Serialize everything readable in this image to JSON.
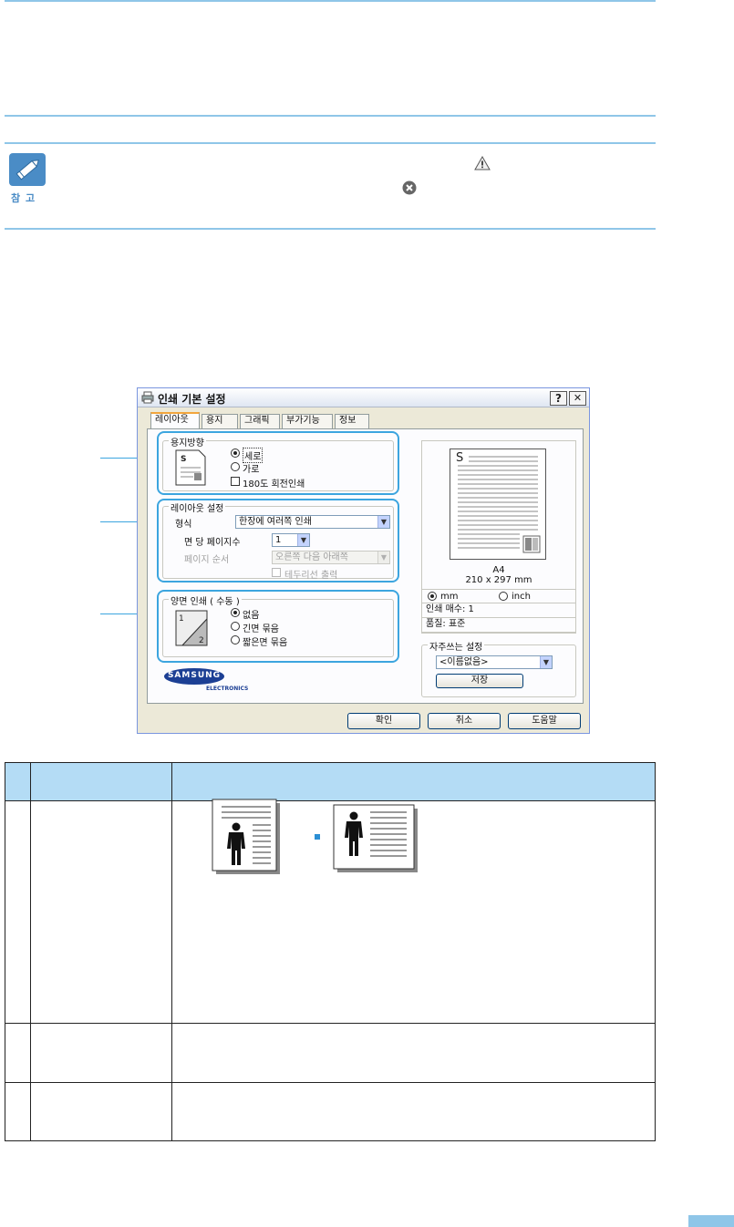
{
  "note": {
    "label": "참 고"
  },
  "dialog": {
    "title": "인쇄 기본 설정",
    "help_btn": "?",
    "close_btn": "✕",
    "tabs": [
      "레이아웃",
      "용지",
      "그래픽",
      "부가기능",
      "정보"
    ],
    "orientation": {
      "title": "용지방향",
      "portrait": "세로",
      "landscape": "가로",
      "rotate": "180도 회전인쇄",
      "selected": "portrait"
    },
    "layout": {
      "title": "레이아웃 설정",
      "type_label": "형식",
      "type_value": "한장에 여러쪽 인쇄",
      "pages_label": "면 당 페이지수",
      "pages_value": "1",
      "order_label": "페이지 순서",
      "order_value": "오른쪽 다음 아래쪽",
      "border_label": "테두리선 출력"
    },
    "duplex": {
      "title": "양면 인쇄 ( 수동 )",
      "none": "없음",
      "long": "긴면 묶음",
      "short": "짧은면 묶음",
      "selected": "none"
    },
    "preview": {
      "letter": "S",
      "paper": "A4",
      "size": "210 x 297 mm",
      "unit_mm": "mm",
      "unit_inch": "inch",
      "copies": "인쇄 매수: 1",
      "quality": "품질: 표준"
    },
    "favorites": {
      "title": "자주쓰는 설정",
      "value": "<이름없음>",
      "save": "저장"
    },
    "brand": {
      "name": "SAMSUNG",
      "sub": "ELECTRONICS"
    },
    "buttons": {
      "ok": "확인",
      "cancel": "취소",
      "help": "도움말"
    }
  },
  "colors": {
    "accent": "#8fc6e8",
    "highlight": "#3ca5df",
    "table_header": "#b4dcf5"
  }
}
